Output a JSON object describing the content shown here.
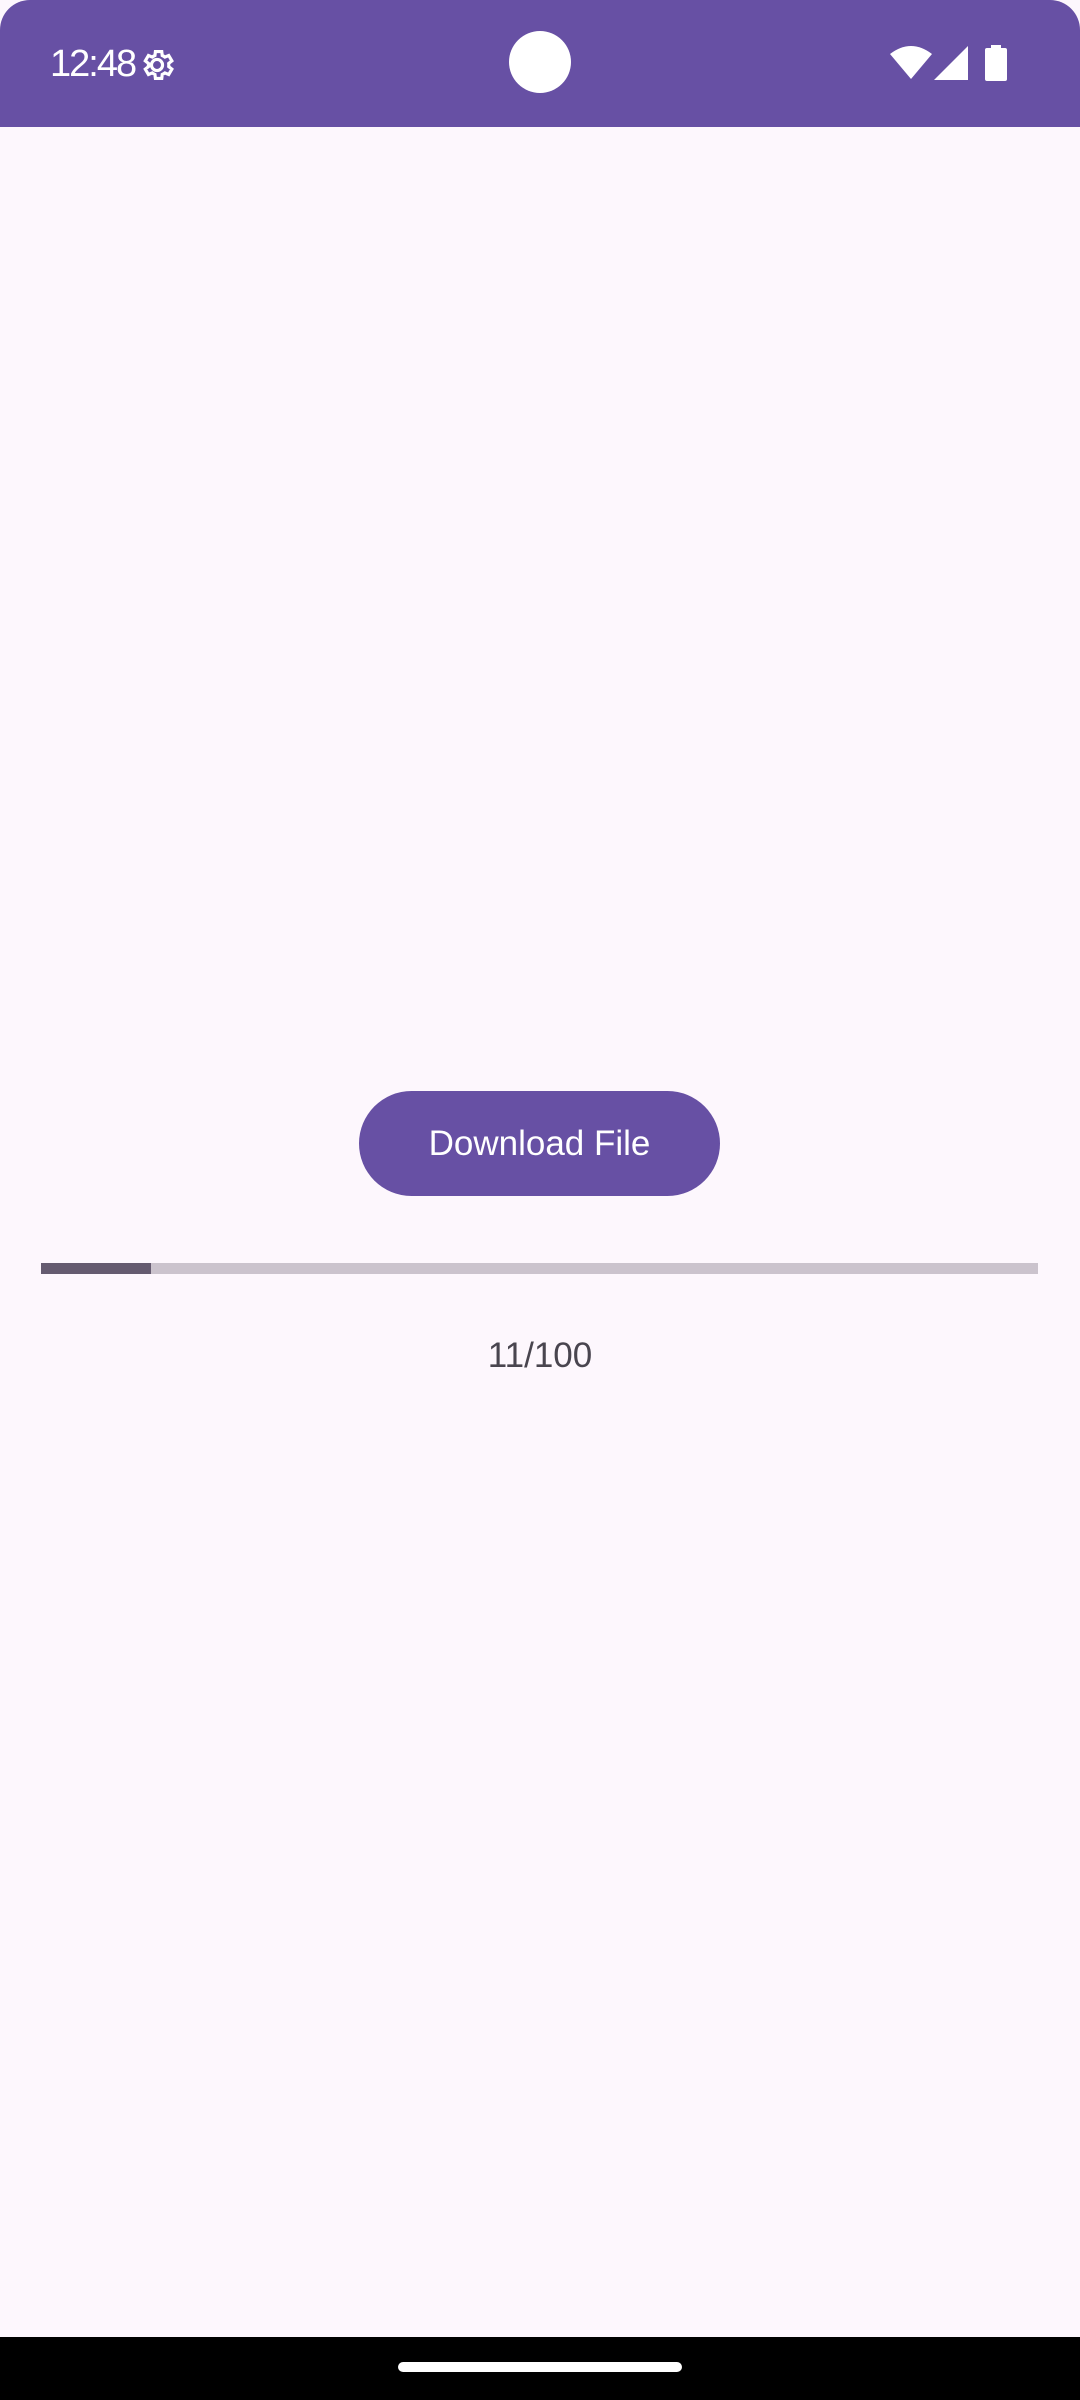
{
  "status_bar": {
    "time": "12:48",
    "icons": [
      "gear-icon",
      "wifi-icon",
      "signal-icon",
      "battery-icon"
    ],
    "background_color": "#6750A4"
  },
  "main": {
    "download_button_label": "Download File",
    "progress": {
      "value": 11,
      "max": 100,
      "label": "11/100"
    }
  },
  "colors": {
    "accent": "#6750A4",
    "background": "#FDF7FD",
    "progress_fill": "#655B70",
    "progress_track": "#CBC3CD"
  }
}
